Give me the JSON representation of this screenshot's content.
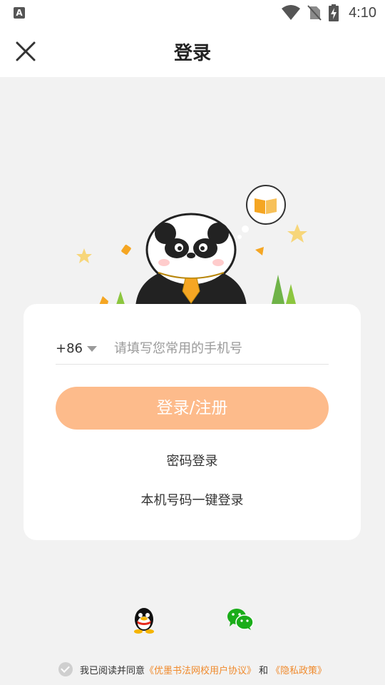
{
  "status_bar": {
    "app_badge": "A",
    "time": "4:10",
    "icons": [
      "wifi-icon",
      "no-sim-icon",
      "battery-charging-icon"
    ]
  },
  "header": {
    "title": "登录",
    "close_icon": "close-icon"
  },
  "login_form": {
    "country_code": "+86",
    "phone_placeholder": "请填写您常用的手机号",
    "phone_value": "",
    "submit_label": "登录/注册",
    "password_login_label": "密码登录",
    "one_click_login_label": "本机号码一键登录"
  },
  "social_login": {
    "qq_icon": "qq-icon",
    "wechat_icon": "wechat-icon"
  },
  "agreement": {
    "prefix": "我已阅读并同意",
    "user_agreement": "《优墨书法网校用户协议》",
    "conjunction": "和",
    "privacy_policy": "《隐私政策》"
  },
  "colors": {
    "primary_button": "#fdbb8b",
    "link_orange": "#f08a2c",
    "background": "#f2f2f2"
  }
}
